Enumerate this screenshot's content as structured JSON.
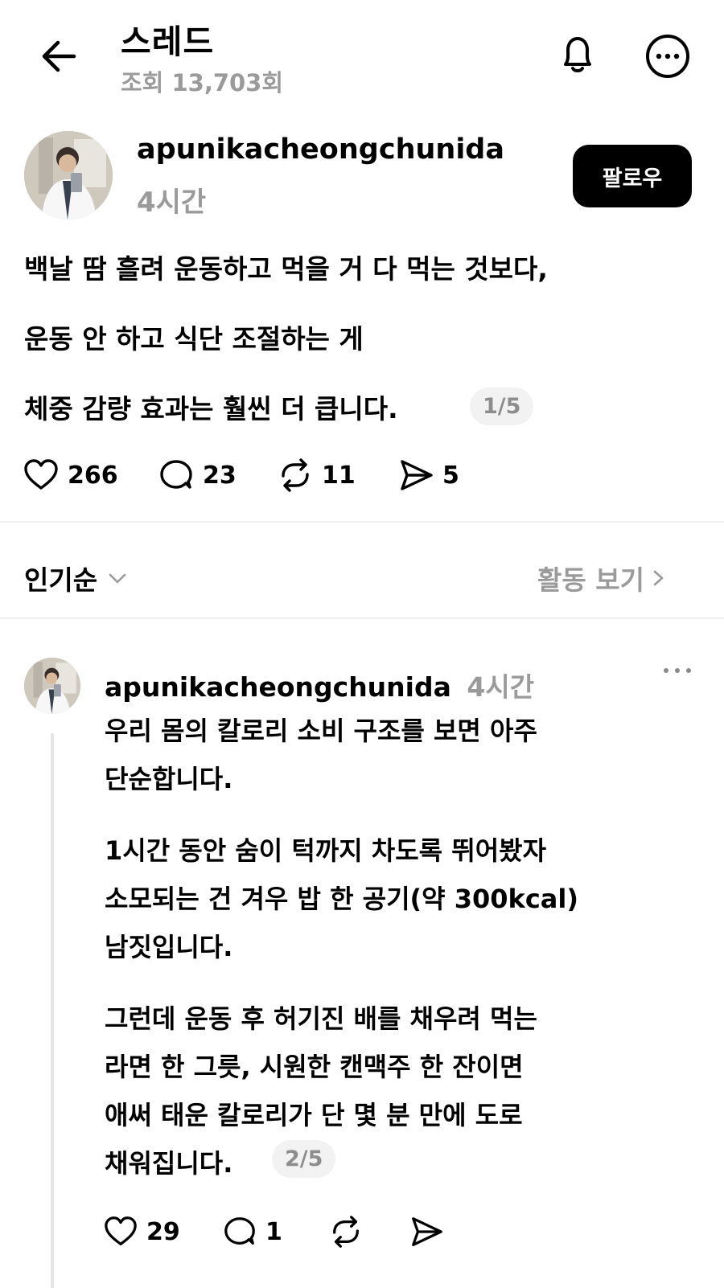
{
  "header": {
    "title": "스레드",
    "views": "조회 13,703회",
    "back_icon": "arrow-left-icon",
    "notify_icon": "bell-icon",
    "more_icon": "more-circle-icon"
  },
  "post": {
    "author": "apunikacheongchunida",
    "time": "4시간",
    "follow_label": "팔로우",
    "lines": [
      "백날 땀 흘려 운동하고 먹을 거 다 먹는 것보다,",
      "운동 안 하고 식단 조절하는 게",
      "체중 감량 효과는 훨씬 더 큽니다."
    ],
    "pager": "1/5",
    "likes": "266",
    "comments": "23",
    "reposts": "11",
    "shares": "5"
  },
  "controls": {
    "sort_label": "인기순",
    "activity_label": "활동 보기"
  },
  "reply": {
    "author": "apunikacheongchunida",
    "time": "4시간",
    "lines": [
      "우리 몸의 칼로리 소비 구조를 보면 아주",
      "단순합니다.",
      "1시간 동안 숨이 턱까지 차도록 뛰어봤자",
      "소모되는 건 겨우 밥 한 공기(약 300kcal)",
      "남짓입니다.",
      "그런데 운동 후 허기진 배를 채우려 먹는",
      "라면 한 그릇, 시원한 캔맥주 한 잔이면",
      "애써 태운 칼로리가 단 몇 분 만에 도로",
      "채워집니다."
    ],
    "pager": "2/5",
    "likes": "29",
    "comments": "1"
  }
}
